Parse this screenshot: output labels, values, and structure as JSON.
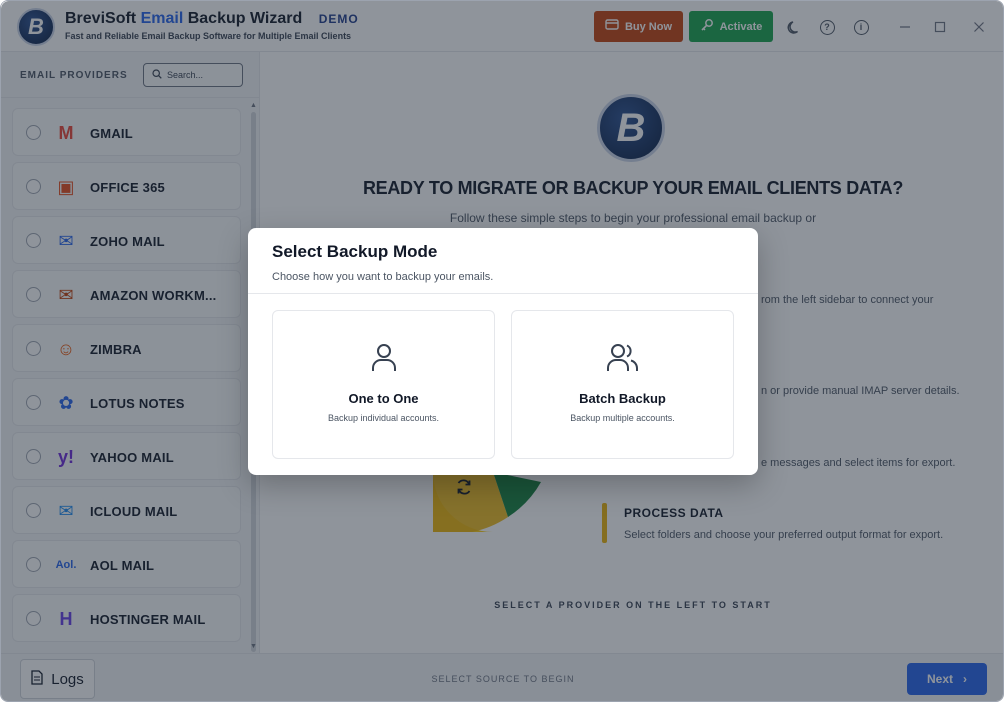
{
  "app": {
    "title_prefix": "BreviSoft",
    "title_accent": "Email",
    "title_suffix": "Backup Wizard",
    "badge": "DEMO",
    "subtitle": "Fast and Reliable Email Backup Software for Multiple Email Clients",
    "logo_letter": "B"
  },
  "toolbar": {
    "buy_label": "Buy Now",
    "activate_label": "Activate",
    "icons": [
      "moon-icon",
      "help-icon",
      "info-icon"
    ],
    "window_controls": [
      "minimize",
      "maximize",
      "close"
    ]
  },
  "sidebar": {
    "header": "EMAIL PROVIDERS",
    "search_placeholder": "Search...",
    "providers": [
      {
        "label": "GMAIL",
        "icon": "gmail-icon",
        "color": "#ea4335",
        "glyph": "M"
      },
      {
        "label": "OFFICE 365",
        "icon": "office365-icon",
        "color": "#e64a19",
        "glyph": "▣"
      },
      {
        "label": "ZOHO MAIL",
        "icon": "zoho-mail-icon",
        "color": "#2563eb",
        "glyph": "✉"
      },
      {
        "label": "AMAZON WORKM...",
        "icon": "amazon-workmail-icon",
        "color": "#c2410c",
        "glyph": "✉"
      },
      {
        "label": "ZIMBRA",
        "icon": "zimbra-icon",
        "color": "#ea580c",
        "glyph": "☺"
      },
      {
        "label": "LOTUS NOTES",
        "icon": "lotus-notes-icon",
        "color": "#2563eb",
        "glyph": "✿"
      },
      {
        "label": "YAHOO MAIL",
        "icon": "yahoo-icon",
        "color": "#6d28d9",
        "glyph": "y!"
      },
      {
        "label": "ICLOUD MAIL",
        "icon": "icloud-mail-icon",
        "color": "#1d8bf0",
        "glyph": "✉"
      },
      {
        "label": "AOL MAIL",
        "icon": "aol-icon",
        "color": "#2563eb",
        "glyph": "Aol."
      },
      {
        "label": "HOSTINGER MAIL",
        "icon": "hostinger-icon",
        "color": "#673de6",
        "glyph": "H"
      }
    ]
  },
  "main": {
    "headline": "READY TO MIGRATE OR BACKUP YOUR EMAIL CLIENTS DATA?",
    "subtext": "Follow these simple steps to begin your professional email backup or",
    "step_fragments": [
      "rom the left sidebar to connect your",
      "n or provide manual IMAP server details.",
      "e messages and select items for export."
    ],
    "process_title": "PROCESS DATA",
    "process_desc": "Select folders and choose your preferred output format for export.",
    "hint": "SELECT A PROVIDER ON THE LEFT TO START"
  },
  "footer": {
    "logs_label": "Logs",
    "status": "SELECT SOURCE TO BEGIN",
    "next_label": "Next"
  },
  "modal": {
    "title": "Select Backup Mode",
    "subtitle": "Choose how you want to backup your emails.",
    "options": [
      {
        "title": "One to One",
        "desc": "Backup individual accounts.",
        "icon": "user-icon"
      },
      {
        "title": "Batch Backup",
        "desc": "Backup multiple accounts.",
        "icon": "users-icon"
      }
    ]
  },
  "colors": {
    "accent": "#2563eb",
    "buy": "#c2410c",
    "activate": "#16a34a",
    "step_bar": "#eab308"
  }
}
